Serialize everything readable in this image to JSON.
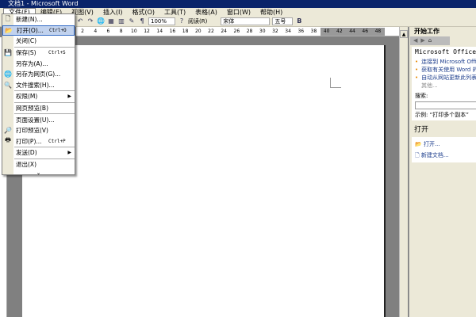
{
  "window": {
    "title": "文档1 - Microsoft Word"
  },
  "menubar": [
    "文件(F)",
    "编辑(E)",
    "视图(V)",
    "插入(I)",
    "格式(O)",
    "工具(T)",
    "表格(A)",
    "窗口(W)",
    "帮助(H)"
  ],
  "toolbar": {
    "zoom": "100%",
    "read": "阅读(R)",
    "font": "宋体",
    "size": "五号",
    "bold": "B"
  },
  "ruler": [
    "2",
    "4",
    "6",
    "8",
    "10",
    "12",
    "14",
    "16",
    "18",
    "20",
    "22",
    "24",
    "26",
    "28",
    "30",
    "32",
    "34",
    "36",
    "38",
    "40",
    "42",
    "44",
    "46",
    "48"
  ],
  "file_menu": [
    {
      "label": "新建(N)...",
      "icon": "new-doc-icon",
      "glyph": "🗋"
    },
    {
      "label": "打开(O)...",
      "shortcut": "Ctrl+O",
      "icon": "open-folder-icon",
      "glyph": "📂",
      "highlight": true
    },
    {
      "label": "关闭(C)"
    },
    {
      "label": "保存(S)",
      "shortcut": "Ctrl+S",
      "icon": "save-icon",
      "glyph": "💾"
    },
    {
      "label": "另存为(A)..."
    },
    {
      "label": "另存为网页(G)...",
      "icon": "save-web-icon",
      "glyph": "🌐"
    },
    {
      "label": "文件搜索(H)...",
      "icon": "file-search-icon",
      "glyph": "🔍"
    },
    {
      "label": "权限(M)",
      "submenu": true
    },
    {
      "label": "网页预览(B)"
    },
    {
      "label": "页面设置(U)..."
    },
    {
      "label": "打印预览(V)",
      "icon": "print-preview-icon",
      "glyph": "🔎"
    },
    {
      "label": "打印(P)...",
      "shortcut": "Ctrl+P",
      "icon": "print-icon",
      "glyph": "🖶"
    },
    {
      "label": "发送(D)",
      "submenu": true
    },
    {
      "label": "退出(X)"
    }
  ],
  "file_menu_more": "⌄",
  "task_pane": {
    "title": "开始工作",
    "office_title": "Microsoft Office",
    "links": [
      "连接到 Microsoft Office Online",
      "获取有关使用 Word 的最新新闻",
      "自动从网站更新此列表"
    ],
    "more": "其他...",
    "search_label": "搜索:",
    "search_value": "",
    "example": "示例: “打印多个副本”",
    "open_heading": "打开",
    "open_link": "打开...",
    "new_doc": "新建文档..."
  }
}
